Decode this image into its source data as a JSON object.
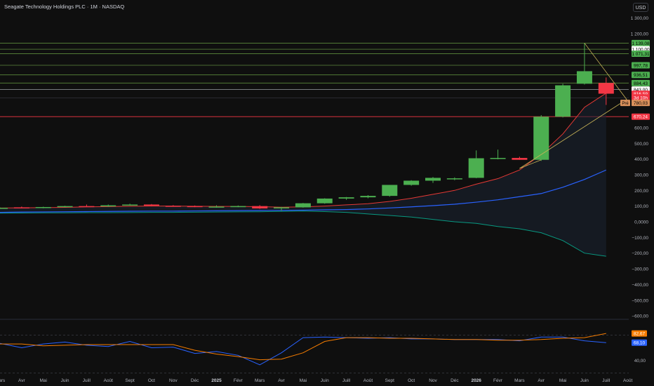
{
  "header": {
    "title": "Seagate Technology Holdings PLC · 1M · NASDAQ",
    "currency_button": "USD"
  },
  "colors": {
    "background": "#0f0f0f",
    "up": "#4caf50",
    "down": "#f23645",
    "ma_red": "#e53935",
    "ma_blue": "#2962ff",
    "band_teal": "#089981",
    "level_line": "#5c8a3c",
    "orange": "#f57c00",
    "yellow": "#c9b458"
  },
  "chart_data": [
    {
      "type": "candlestick",
      "title": "Seagate Technology Holdings PLC · 1M · NASDAQ",
      "x": [
        "Mars",
        "Avr",
        "Mai",
        "Juin",
        "Juill",
        "Août",
        "Sept",
        "Oct",
        "Nov",
        "Déc",
        "2025",
        "Févr",
        "Mars",
        "Avr",
        "Mai",
        "Juin",
        "Juill",
        "Août",
        "Sept",
        "Oct",
        "Nov",
        "Déc",
        "2026",
        "Févr",
        "Mars",
        "Avr",
        "Mai",
        "Juin",
        "Juill",
        "Août"
      ],
      "candles": [
        {
          "x": "Mars",
          "o": 85,
          "h": 92,
          "l": 82,
          "c": 89
        },
        {
          "x": "Avr",
          "o": 92,
          "h": 97,
          "l": 86,
          "c": 89
        },
        {
          "x": "Mai",
          "o": 89,
          "h": 96,
          "l": 86,
          "c": 94
        },
        {
          "x": "Juin",
          "o": 94,
          "h": 102,
          "l": 92,
          "c": 100
        },
        {
          "x": "Juill",
          "o": 100,
          "h": 110,
          "l": 97,
          "c": 98
        },
        {
          "x": "Août",
          "o": 98,
          "h": 110,
          "l": 95,
          "c": 105
        },
        {
          "x": "Sept",
          "o": 105,
          "h": 115,
          "l": 103,
          "c": 110
        },
        {
          "x": "Oct",
          "o": 110,
          "h": 113,
          "l": 101,
          "c": 102
        },
        {
          "x": "Nov",
          "o": 102,
          "h": 106,
          "l": 96,
          "c": 100
        },
        {
          "x": "Déc",
          "o": 100,
          "h": 104,
          "l": 93,
          "c": 95
        },
        {
          "x": "2025",
          "o": 95,
          "h": 105,
          "l": 90,
          "c": 97
        },
        {
          "x": "Févr",
          "o": 97,
          "h": 104,
          "l": 93,
          "c": 100
        },
        {
          "x": "Mars",
          "o": 100,
          "h": 106,
          "l": 82,
          "c": 85
        },
        {
          "x": "Avr",
          "o": 85,
          "h": 95,
          "l": 70,
          "c": 92
        },
        {
          "x": "Mai",
          "o": 92,
          "h": 120,
          "l": 90,
          "c": 118
        },
        {
          "x": "Juin",
          "o": 118,
          "h": 150,
          "l": 115,
          "c": 148
        },
        {
          "x": "Juill",
          "o": 148,
          "h": 158,
          "l": 140,
          "c": 156
        },
        {
          "x": "Août",
          "o": 156,
          "h": 170,
          "l": 150,
          "c": 165
        },
        {
          "x": "Sept",
          "o": 165,
          "h": 235,
          "l": 160,
          "c": 235
        },
        {
          "x": "Oct",
          "o": 235,
          "h": 265,
          "l": 230,
          "c": 262
        },
        {
          "x": "Nov",
          "o": 262,
          "h": 285,
          "l": 248,
          "c": 280
        },
        {
          "x": "Déc",
          "o": 272,
          "h": 283,
          "l": 265,
          "c": 277
        },
        {
          "x": "2026",
          "o": 280,
          "h": 455,
          "l": 278,
          "c": 405
        },
        {
          "x": "Févr",
          "o": 405,
          "h": 460,
          "l": 398,
          "c": 407
        },
        {
          "x": "Mars",
          "o": 407,
          "h": 415,
          "l": 395,
          "c": 395
        },
        {
          "x": "Avr",
          "o": 395,
          "h": 680,
          "l": 388,
          "c": 670
        },
        {
          "x": "Mai",
          "o": 670,
          "h": 880,
          "l": 665,
          "c": 870
        },
        {
          "x": "Juin",
          "o": 880,
          "h": 1139.08,
          "l": 875,
          "c": 960
        },
        {
          "x": "Juill",
          "o": 885,
          "h": 920,
          "l": 745,
          "c": 816.59
        }
      ],
      "y_ticks": [
        "1 300,00",
        "1 200,00",
        "600,00",
        "500,00",
        "400,00",
        "300,00",
        "200,00",
        "100,00",
        "0,0000",
        "−100,00",
        "−200,00",
        "−300,00",
        "−400,00",
        "−500,00",
        "−600,00"
      ],
      "ylim": [
        -650,
        1350
      ],
      "horizontal_levels": [
        1139.08,
        1100.0,
        1071.31,
        997.78,
        936.51,
        884.43,
        843.0,
        670.24
      ],
      "price_labels": [
        {
          "text": "1 139,08",
          "value": 1139.08,
          "bg": "#4caf50",
          "fg": "#000000"
        },
        {
          "text": "1 100,00",
          "value": 1100.0,
          "bg": "#ffffff",
          "fg": "#000000"
        },
        {
          "text": "1 071,31",
          "value": 1071.31,
          "bg": "#4caf50",
          "fg": "#000000"
        },
        {
          "text": "997,78",
          "value": 997.78,
          "bg": "#4caf50",
          "fg": "#000000"
        },
        {
          "text": "936,51",
          "value": 936.51,
          "bg": "#4caf50",
          "fg": "#000000"
        },
        {
          "text": "884,43",
          "value": 884.43,
          "bg": "#4caf50",
          "fg": "#000000"
        },
        {
          "text": "843,00",
          "value": 843.0,
          "bg": "#ffffff",
          "fg": "#000000"
        },
        {
          "text": "816,59",
          "value": 816.59,
          "bg": "#f23645",
          "fg": "#ffffff"
        },
        {
          "text": "3d 10h",
          "value": 793,
          "bg": "#f23645",
          "fg": "#ffffff"
        },
        {
          "text": "780,03",
          "value": 758,
          "bg": "#d9905b",
          "fg": "#000000"
        },
        {
          "text": "670,24",
          "value": 670.24,
          "bg": "#f23645",
          "fg": "#ffffff"
        }
      ],
      "pre_badge": "Pré",
      "ma_red": [
        88,
        89,
        90,
        92,
        95,
        97,
        99,
        100,
        100,
        99,
        98,
        98,
        96,
        93,
        95,
        100,
        108,
        115,
        130,
        150,
        175,
        200,
        240,
        275,
        330,
        430,
        560,
        730,
        820
      ],
      "ma_blue": [
        60,
        62,
        63,
        64,
        65,
        66,
        67,
        68,
        68,
        69,
        70,
        71,
        72,
        73,
        74,
        76,
        78,
        82,
        88,
        95,
        103,
        112,
        125,
        140,
        160,
        180,
        220,
        270,
        330
      ],
      "band_lower": [
        55,
        56,
        57,
        57,
        58,
        58,
        59,
        60,
        60,
        61,
        62,
        63,
        64,
        66,
        68,
        65,
        60,
        50,
        40,
        30,
        15,
        0,
        -10,
        -30,
        -45,
        -70,
        -120,
        -200,
        -220
      ]
    },
    {
      "type": "line",
      "series": [
        {
          "color": "#2962ff",
          "values": [
            67,
            60,
            66,
            69,
            64,
            62,
            70,
            60,
            61,
            51,
            54,
            48,
            33,
            52,
            76,
            77,
            76,
            75,
            76,
            74,
            74,
            73,
            73,
            73,
            71,
            77,
            77,
            71,
            68.1
          ]
        },
        {
          "color": "#f57c00",
          "values": [
            66,
            66,
            63,
            64,
            65,
            65,
            65,
            65,
            65,
            56,
            50,
            46,
            41,
            42,
            52,
            70,
            76,
            76,
            75,
            75,
            74,
            73,
            73,
            72,
            72,
            73,
            75,
            76,
            82.67
          ]
        }
      ],
      "ylim": [
        25,
        95
      ],
      "y_ticks": [
        "40,00"
      ],
      "value_labels": [
        {
          "text": "82,67",
          "bg": "#f57c00"
        },
        {
          "text": "68,10",
          "bg": "#2962ff"
        }
      ],
      "reference_lines": [
        80,
        20
      ]
    }
  ]
}
